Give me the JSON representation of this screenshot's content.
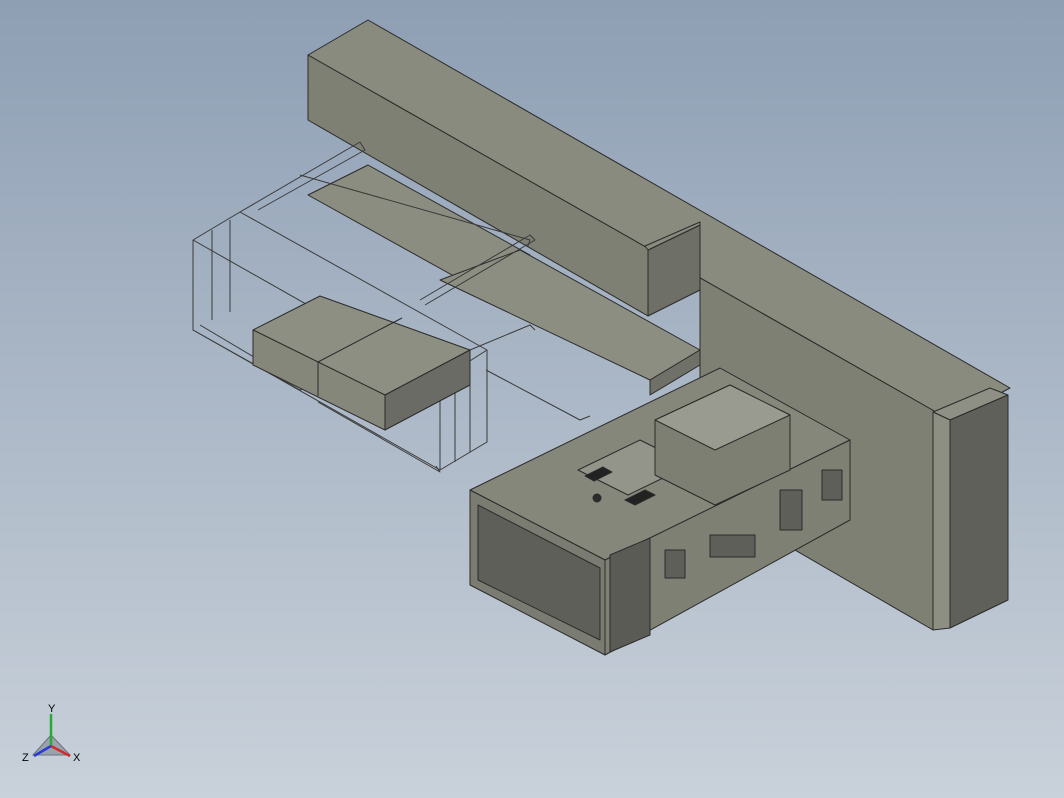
{
  "viewport": {
    "background_top": "#8e9fb4",
    "background_bottom": "#c9d1da",
    "model_face_color": "#85857a",
    "model_dark_face_color": "#5f605a",
    "model_edge_color": "#2b2b2b"
  },
  "triad": {
    "x_label": "X",
    "y_label": "Y",
    "z_label": "Z",
    "x_color": "#d42a2a",
    "y_color": "#2aa83a",
    "z_color": "#2a3ad4"
  }
}
